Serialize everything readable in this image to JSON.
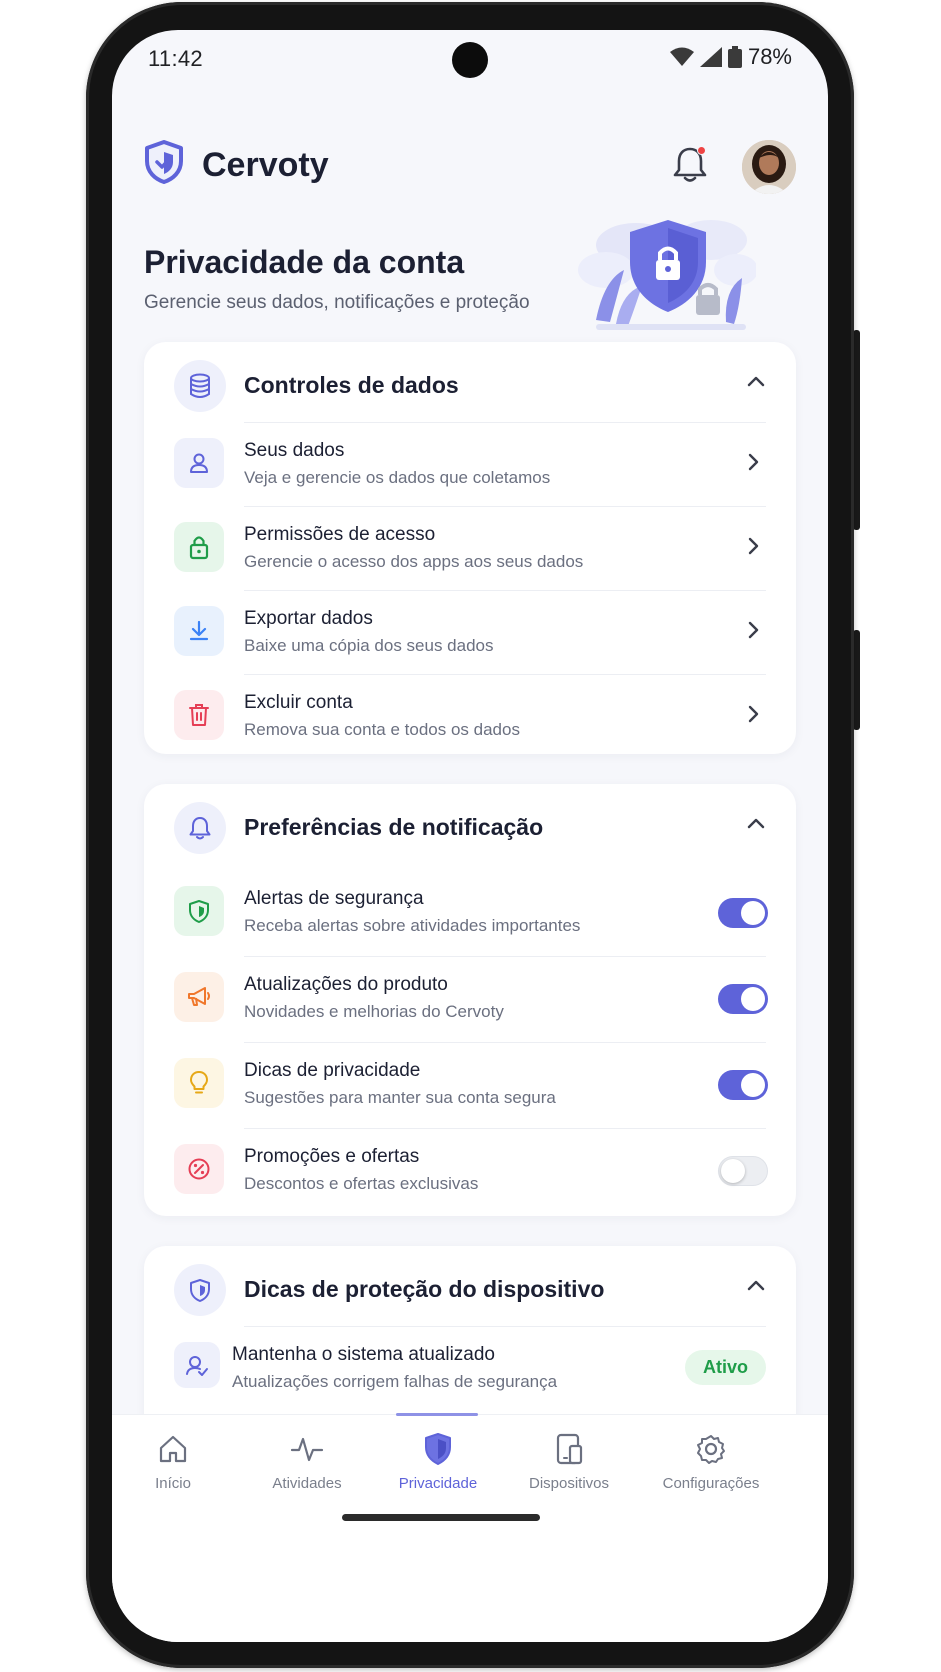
{
  "status_bar": {
    "time": "11:42",
    "battery": "78%"
  },
  "header": {
    "brand": "Cervoty",
    "avatar": "user-avatar"
  },
  "hero": {
    "title": "Privacidade da conta",
    "subtitle": "Gerencie seus dados, notificações e proteção"
  },
  "data_controls": {
    "title": "Controles de dados",
    "items": [
      {
        "title": "Seus dados",
        "subtitle": "Veja e gerencie os dados que coletamos",
        "icon": "user-icon",
        "color": "#5e63d9"
      },
      {
        "title": "Permissões de acesso",
        "subtitle": "Gerencie o acesso dos apps aos seus dados",
        "icon": "lock-icon",
        "color": "#1f9d49"
      },
      {
        "title": "Exportar dados",
        "subtitle": "Baixe uma cópia dos seus dados",
        "icon": "download-icon",
        "color": "#3b82f6"
      },
      {
        "title": "Excluir conta",
        "subtitle": "Remova sua conta e todos os dados",
        "icon": "trash-icon",
        "color": "#e53e55"
      }
    ]
  },
  "notifications": {
    "title": "Preferências de notificação",
    "items": [
      {
        "title": "Alertas de segurança",
        "subtitle": "Receba alertas sobre atividades importantes",
        "icon": "shield-check-icon",
        "enabled": true
      },
      {
        "title": "Atualizações do produto",
        "subtitle": "Novidades e melhorias do Cervoty",
        "icon": "megaphone-icon",
        "enabled": true
      },
      {
        "title": "Dicas de privacidade",
        "subtitle": "Sugestões para manter sua conta segura",
        "icon": "lightbulb-icon",
        "enabled": true
      },
      {
        "title": "Promoções e ofertas",
        "subtitle": "Descontos e ofertas exclusivas",
        "icon": "discount-icon",
        "enabled": false
      }
    ]
  },
  "device_tips": {
    "title": "Dicas de proteção do dispositivo",
    "items": [
      {
        "title": "Mantenha o sistema atualizado",
        "subtitle": "Atualizações corrigem falhas de segurança",
        "badge": "Ativo",
        "icon": "system-update-icon"
      }
    ]
  },
  "bottom_nav": {
    "items": [
      {
        "label": "Início",
        "icon": "home-icon"
      },
      {
        "label": "Atividades",
        "icon": "activity-icon"
      },
      {
        "label": "Privacidade",
        "icon": "shield-icon",
        "active": true
      },
      {
        "label": "Dispositivos",
        "icon": "devices-icon"
      },
      {
        "label": "Configurações",
        "icon": "gear-icon"
      }
    ]
  },
  "colors": {
    "accent": "#5e63d9",
    "background": "#f6f7fb",
    "success": "#1f9d49",
    "danger": "#e53e55"
  }
}
